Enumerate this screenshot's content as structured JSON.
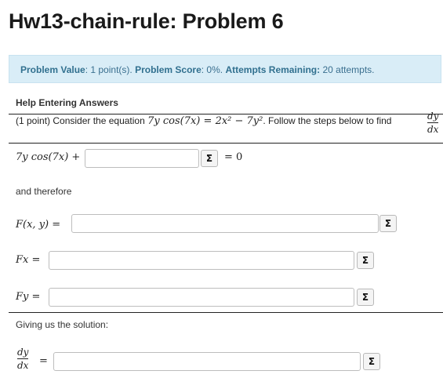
{
  "page": {
    "title": "Hw13-chain-rule: Problem 6"
  },
  "status": {
    "value_label": "Problem Value",
    "value_text": ": 1 point(s). ",
    "score_label": "Problem Score",
    "score_text": ": 0%. ",
    "attempts_label": "Attempts Remaining:",
    "attempts_text": " 20 attempts."
  },
  "help": {
    "link": "Help Entering Answers"
  },
  "statement": {
    "prefix": "(1 point) Consider the equation ",
    "eq_lhs": "7y cos(7x)",
    "eq_eq": " = ",
    "eq_rhs": "2x² − 7y²",
    "suffix": ". Follow the steps below to find",
    "frac_num": "dy",
    "frac_den": "dx"
  },
  "step1": {
    "lhs": "7y cos(7x) +",
    "rhs": "= 0",
    "value": ""
  },
  "and_therefore": "and therefore",
  "F": {
    "label": "F(x, y) =",
    "value": ""
  },
  "Fx": {
    "label": "Fx =",
    "value": ""
  },
  "Fy": {
    "label": "Fy =",
    "value": ""
  },
  "solution": {
    "text": "Giving us the solution:",
    "frac_num": "dy",
    "frac_den": "dx",
    "eq": "=",
    "value": ""
  },
  "icons": {
    "sigma": "Σ"
  }
}
